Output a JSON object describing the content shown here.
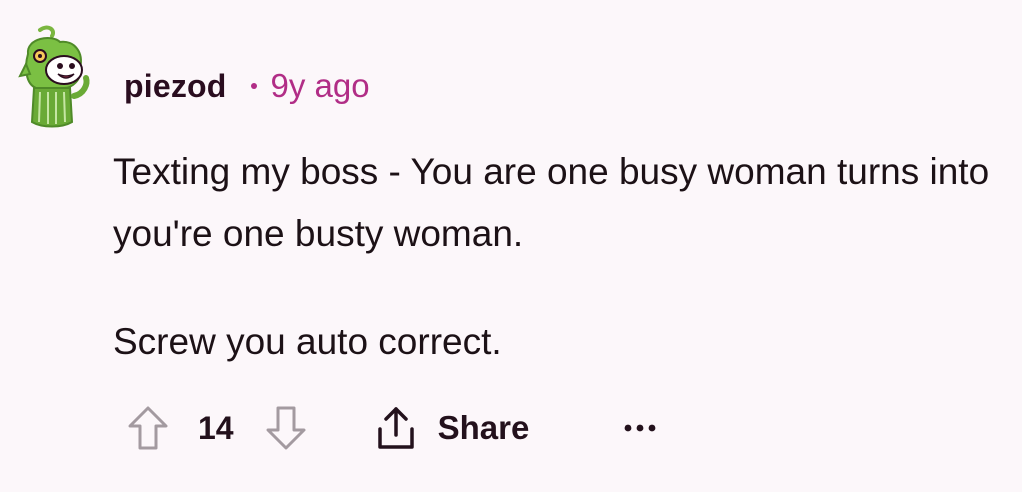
{
  "comment": {
    "author": "piezod",
    "time_ago": "9y ago",
    "paragraphs": [
      "Texting my boss - You are one busy woman turns into you're one busty woman.",
      "Screw you auto correct."
    ],
    "score": "14",
    "share_label": "Share"
  },
  "icons": {
    "avatar": "avatar-image",
    "upvote": "upvote-arrow-icon",
    "downvote": "downvote-arrow-icon",
    "share": "share-upload-icon",
    "more": "more-options-icon"
  },
  "colors": {
    "background": "#fcf7fa",
    "username": "#2a0d1f",
    "timestamp": "#b12d86",
    "body_text": "#1c1116",
    "icon_gray": "#a39aa0"
  }
}
